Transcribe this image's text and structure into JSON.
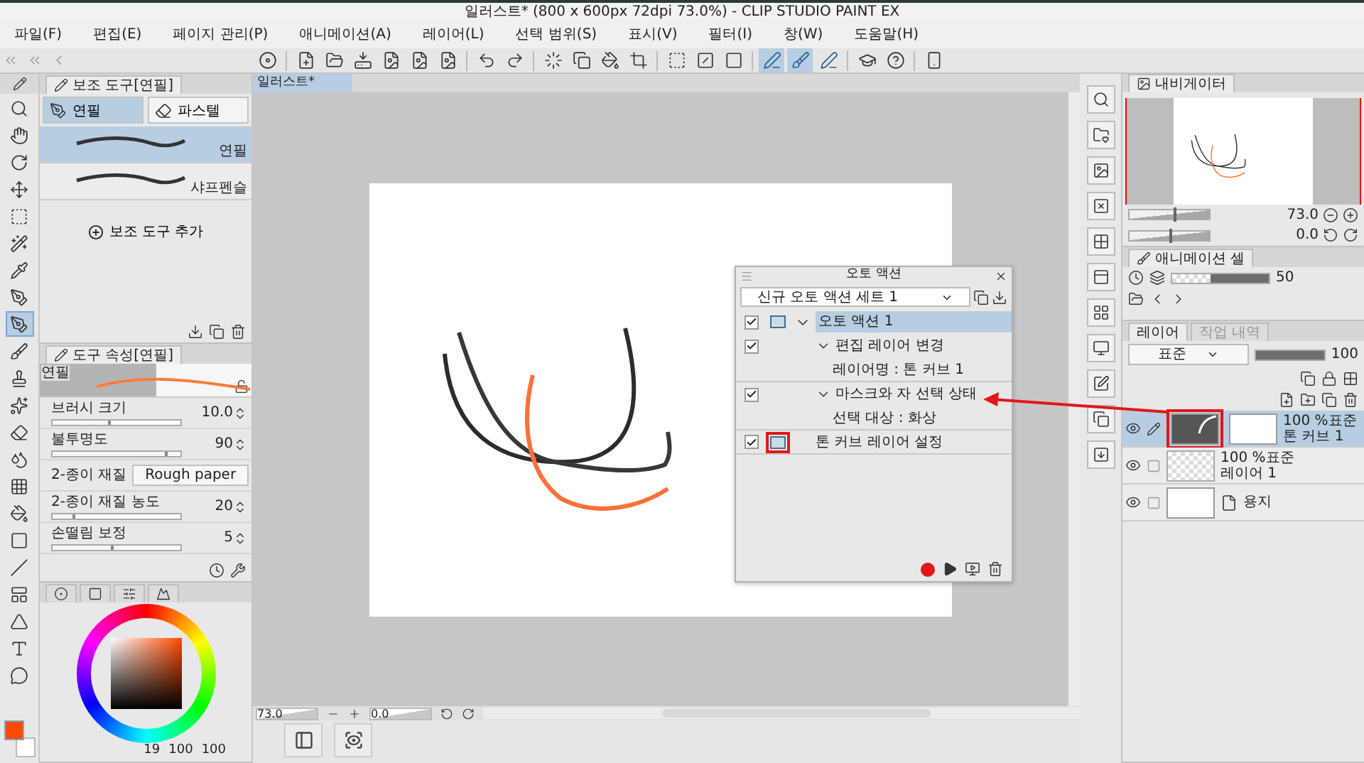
{
  "window": {
    "title": "일러스트* (800 x 600px 72dpi 73.0%)  - CLIP STUDIO PAINT EX"
  },
  "menu": [
    "파일(F)",
    "편집(E)",
    "페이지 관리(P)",
    "애니메이션(A)",
    "레이어(L)",
    "선택 범위(S)",
    "표시(V)",
    "필터(I)",
    "창(W)",
    "도움말(H)"
  ],
  "toolbar_toggles": [
    {
      "on": true
    },
    {
      "on": true
    },
    {
      "on": false
    }
  ],
  "tools": [
    {
      "selected": false
    },
    {
      "selected": false
    },
    {
      "selected": false
    },
    {
      "selected": false
    },
    {
      "selected": false
    },
    {
      "selected": false
    },
    {
      "selected": false
    },
    {
      "selected": false
    },
    {
      "selected": true
    },
    {
      "selected": false
    },
    {
      "selected": false
    },
    {
      "selected": false
    },
    {
      "selected": false
    },
    {
      "selected": false
    },
    {
      "selected": false
    },
    {
      "selected": false
    },
    {
      "selected": false
    },
    {
      "selected": false
    },
    {
      "selected": false
    },
    {
      "selected": false
    },
    {
      "selected": false
    },
    {
      "selected": false
    }
  ],
  "sub_tool": {
    "title": "보조 도구[연필]",
    "groups": [
      {
        "label": "연필",
        "selected": true
      },
      {
        "label": "파스텔",
        "selected": false
      }
    ],
    "items": [
      {
        "label": "연필",
        "selected": true
      },
      {
        "label": "샤프펜슬",
        "selected": false
      }
    ],
    "add_label": "보조 도구 추가"
  },
  "tool_property": {
    "title": "도구 속성[연필]",
    "preview_label": "연필",
    "properties": [
      {
        "kind": "slider",
        "label": "브러시 크기",
        "value": "10.0",
        "level": 0.45
      },
      {
        "kind": "slider",
        "label": "불투명도",
        "value": "90",
        "level": 0.9
      },
      {
        "kind": "select",
        "label": "2-종이 재질",
        "value": "Rough paper"
      },
      {
        "kind": "slider",
        "label": "2-종이 재질 농도",
        "value": "20",
        "level": 0.18
      },
      {
        "kind": "slider",
        "label": "손떨림 보정",
        "value": "5",
        "level": 0.48
      }
    ]
  },
  "color": {
    "swatches": [
      {
        "kind": "main",
        "color": "#ff4a00"
      },
      {
        "kind": "sub",
        "color": "#ffffff"
      }
    ],
    "readout": [
      "19",
      "100",
      "100"
    ]
  },
  "canvas": {
    "tab": "일러스트*",
    "zoom": "73.0",
    "angle": "0.0"
  },
  "auto_action": {
    "title": "오토 액션",
    "set": "신규 오토 액션 세트 1",
    "steps": [
      {
        "kind": "action",
        "label": "오토 액션 1",
        "checked": true,
        "selected": true,
        "dialog": true,
        "highlighted": false,
        "children": [
          {
            "kind": "command",
            "label": "편집 레이어 변경",
            "checked": true,
            "children": [
              {
                "kind": "detail",
                "label": "레이어명 : 톤 커브 1"
              }
            ]
          },
          {
            "kind": "command",
            "label": "마스크와 자 선택 상태",
            "checked": true,
            "children": [
              {
                "kind": "detail",
                "label": "선택 대상 : 화상"
              }
            ]
          },
          {
            "kind": "command",
            "label": "톤 커브 레이어 설정",
            "checked": true,
            "dialog": true,
            "highlighted": true
          }
        ]
      }
    ]
  },
  "navigator": {
    "title": "내비게이터",
    "zoom": "73.0",
    "angle": "0.0",
    "zoom_slider": {
      "level": 0.55
    },
    "rotation_slider": {
      "level": 0.5
    }
  },
  "animation_cel": {
    "title": "애니메이션 셀",
    "opacity": "50",
    "level": 0.6
  },
  "layers": {
    "tabs": [
      {
        "label": "레이어",
        "selected": true
      },
      {
        "label": "작업 내역",
        "selected": false
      }
    ],
    "blend": "표준",
    "opacity": "100",
    "level": 1,
    "items": [
      {
        "kind": "tone_curve",
        "mode": "100 %표준",
        "name": "톤 커브 1",
        "selected": true,
        "visible": true,
        "highlighted": true
      },
      {
        "kind": "raster",
        "mode": "100 %표준",
        "name": "레이어 1",
        "selected": false,
        "visible": true
      },
      {
        "kind": "paper",
        "name": "용지",
        "selected": false,
        "visible": true
      }
    ]
  }
}
